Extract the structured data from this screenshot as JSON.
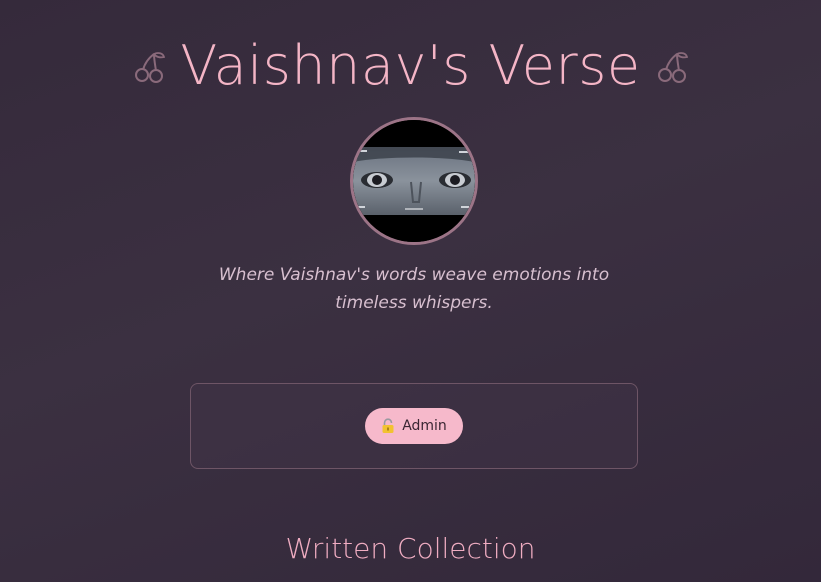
{
  "header": {
    "title": "Vaishnav's Verse",
    "left_icon": "cherry-icon",
    "right_icon": "cherry-icon"
  },
  "profile": {
    "avatar": "profile-avatar"
  },
  "tagline": "Where Vaishnav's words weave emotions into timeless whispers.",
  "admin": {
    "button_label": "Admin",
    "icon": "lock-icon"
  },
  "collection": {
    "title": "Written Collection"
  },
  "colors": {
    "accent": "#f4b5c6",
    "background": "#3a2f40",
    "button_bg": "#f6b9cb"
  }
}
